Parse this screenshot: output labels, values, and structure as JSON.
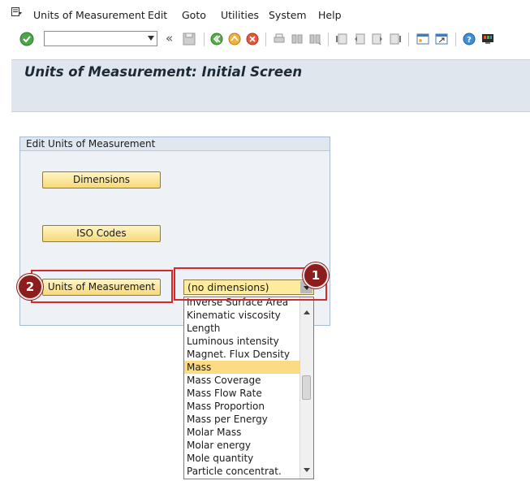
{
  "menu": {
    "items": [
      "Units of Measurement",
      "Edit",
      "Goto",
      "Utilities",
      "System",
      "Help"
    ]
  },
  "toolbar": {
    "command_field_value": "",
    "icons": [
      "enter-icon",
      "save-icon",
      "back-icon",
      "exit-icon",
      "cancel-icon",
      "print-icon",
      "find-icon",
      "find-next-icon",
      "first-page-icon",
      "previous-page-icon",
      "next-page-icon",
      "last-page-icon",
      "create-session-icon",
      "shortcut-icon",
      "help-icon",
      "layout-icon"
    ]
  },
  "screen": {
    "title": "Units of Measurement: Initial Screen"
  },
  "group": {
    "title": "Edit Units of Measurement",
    "dimensions_button": "Dimensions",
    "iso_codes_button": "ISO Codes",
    "uom_button": "Units of Measurement"
  },
  "dropdown": {
    "value": "(no dimensions)",
    "options": [
      "Inverse Surface Area",
      "Kinematic viscosity",
      "Length",
      "Luminous intensity",
      "Magnet. Flux Density",
      "Mass",
      "Mass Coverage",
      "Mass Flow Rate",
      "Mass Proportion",
      "Mass per Energy",
      "Molar Mass",
      "Molar energy",
      "Mole quantity",
      "Particle concentrat."
    ],
    "selected": "Mass"
  },
  "annotations": {
    "badge1": "1",
    "badge2": "2"
  },
  "colors": {
    "highlight": "#d32b2b",
    "badge": "#8d1c1c",
    "button_fill": "#f7d97a",
    "selected_option": "#fbdb83"
  }
}
